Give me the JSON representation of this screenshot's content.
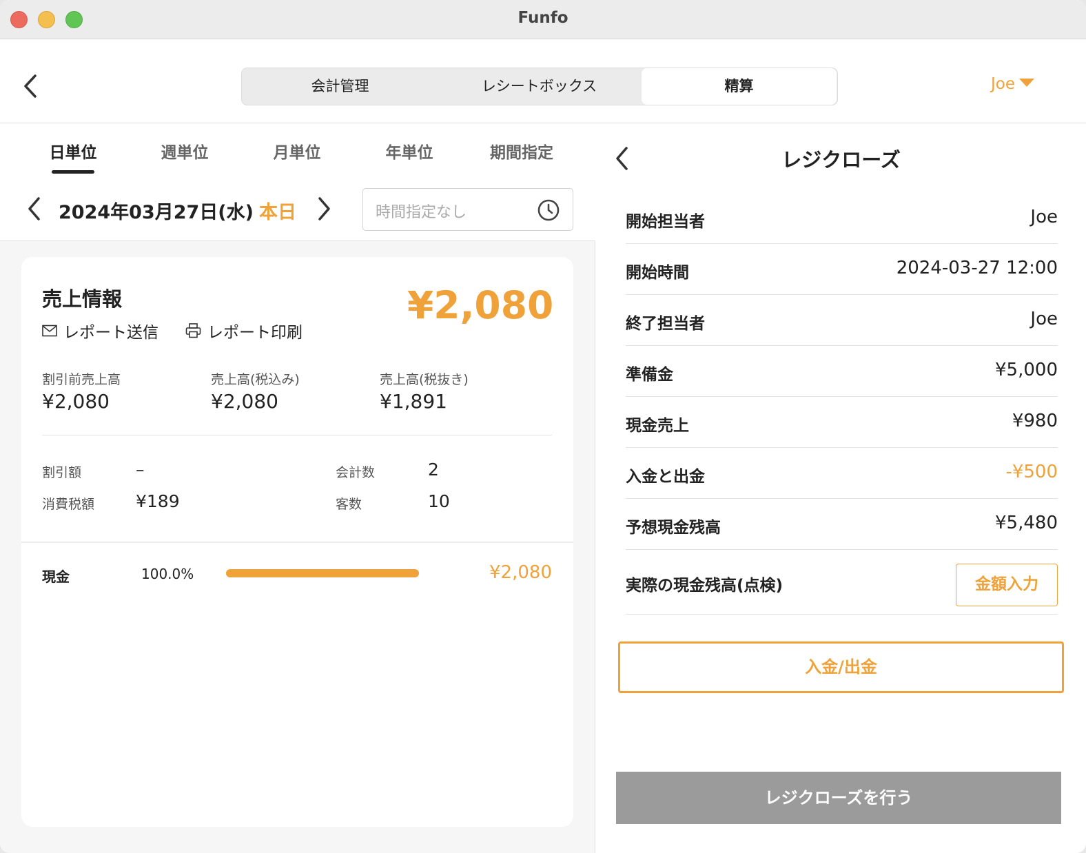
{
  "window": {
    "title": "Funfo"
  },
  "header": {
    "tabs": [
      {
        "label": "会計管理"
      },
      {
        "label": "レシートボックス"
      },
      {
        "label": "精算"
      }
    ],
    "active_tab": "精算",
    "user": "Joe"
  },
  "left": {
    "period_tabs": [
      {
        "label": "日単位"
      },
      {
        "label": "週単位"
      },
      {
        "label": "月単位"
      },
      {
        "label": "年単位"
      },
      {
        "label": "期間指定"
      }
    ],
    "active_period": "日単位",
    "date": "2024年03月27日(水)",
    "today_label": "本日",
    "time_placeholder": "時間指定なし",
    "sales": {
      "title": "売上情報",
      "total": "¥2,080",
      "send_report": "レポート送信",
      "print_report": "レポート印刷",
      "stats": [
        {
          "label": "割引前売上高",
          "value": "¥2,080"
        },
        {
          "label": "売上高(税込み)",
          "value": "¥2,080"
        },
        {
          "label": "売上高(税抜き)",
          "value": "¥1,891"
        }
      ],
      "discount_label": "割引額",
      "discount_value": "–",
      "tax_label": "消費税額",
      "tax_value": "¥189",
      "txn_label": "会計数",
      "txn_value": "2",
      "customers_label": "客数",
      "customers_value": "10"
    },
    "payment": {
      "label": "現金",
      "percent": "100.0%",
      "fraction": 1.0,
      "amount": "¥2,080"
    }
  },
  "right": {
    "title": "レジクローズ",
    "rows": [
      {
        "label": "開始担当者",
        "value": "Joe"
      },
      {
        "label": "開始時間",
        "value": "2024-03-27 12:00"
      },
      {
        "label": "終了担当者",
        "value": "Joe"
      },
      {
        "label": "準備金",
        "value": "¥5,000"
      },
      {
        "label": "現金売上",
        "value": "¥980"
      },
      {
        "label": "入金と出金",
        "value": "-¥500"
      },
      {
        "label": "予想現金残高",
        "value": "¥5,480"
      }
    ],
    "actual_label": "実際の現金残高(点検)",
    "amount_input_button": "金額入力",
    "cash_in_out_button": "入金/出金",
    "close_button": "レジクローズを行う"
  },
  "colors": {
    "accent": "#f0a23a",
    "disabled": "#9b9b9b"
  }
}
